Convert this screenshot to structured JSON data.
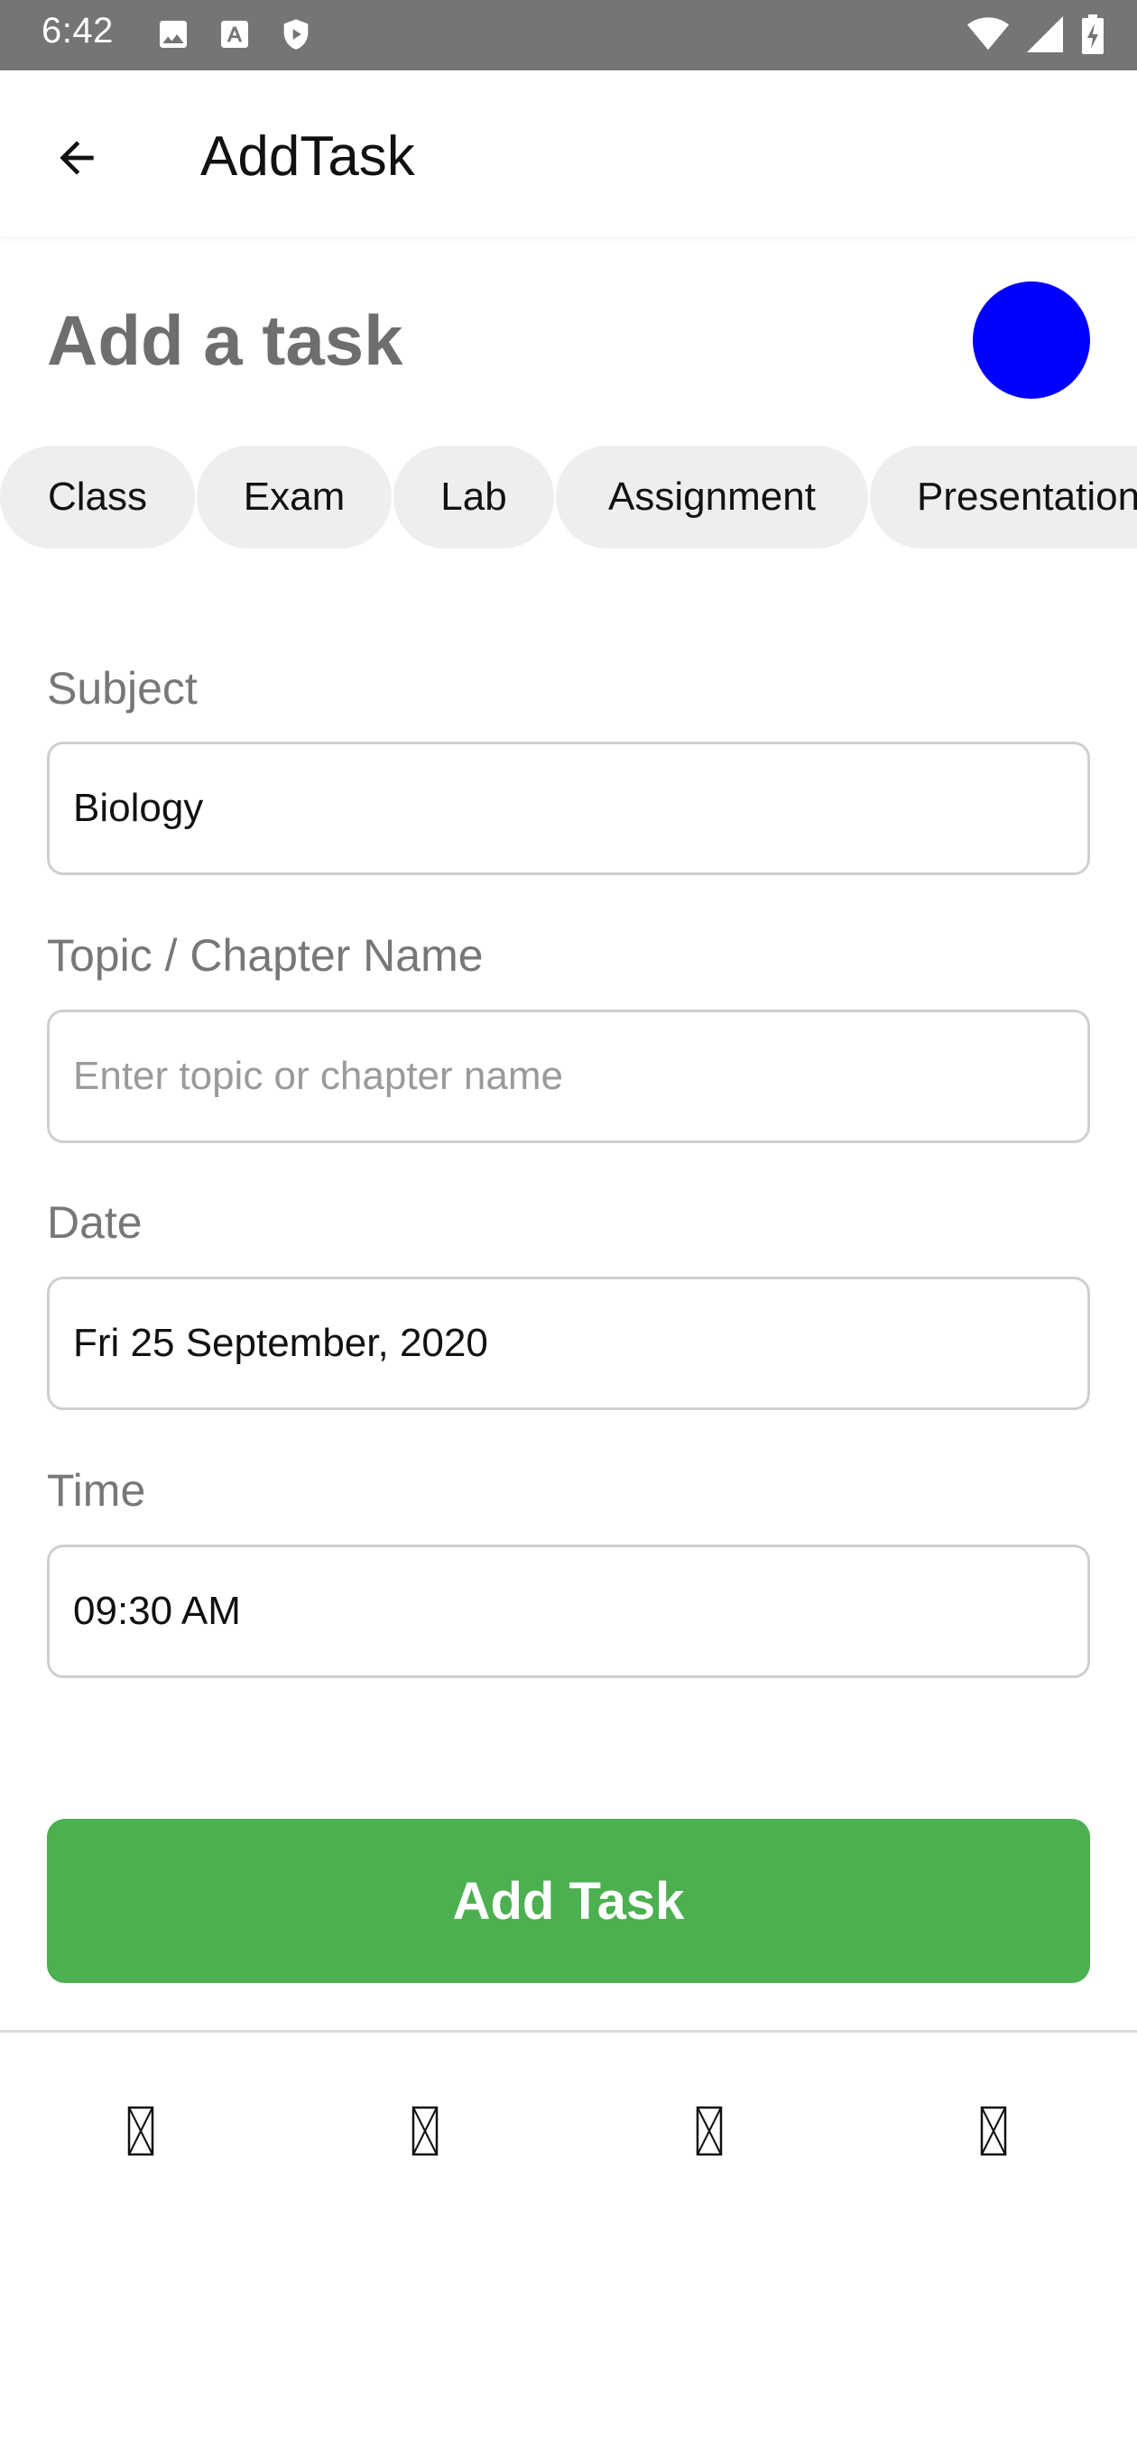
{
  "status_bar": {
    "time": "6:42",
    "left_icons": [
      "image-icon",
      "font-icon",
      "shield-play-icon"
    ],
    "right_icons": [
      "wifi-icon",
      "cell-signal-icon",
      "battery-charging-icon"
    ]
  },
  "app_bar": {
    "back_icon": "arrow-back-icon",
    "title": "AddTask"
  },
  "header": {
    "heading": "Add a task",
    "selected_color": "#0000ff"
  },
  "chips": [
    {
      "label": "Class"
    },
    {
      "label": "Exam"
    },
    {
      "label": "Lab"
    },
    {
      "label": "Assignment"
    },
    {
      "label": "Presentation"
    }
  ],
  "form": {
    "subject": {
      "label": "Subject",
      "value": "Biology"
    },
    "topic": {
      "label": "Topic / Chapter Name",
      "value": "",
      "placeholder": "Enter topic or chapter name"
    },
    "date": {
      "label": "Date",
      "value": "Fri 25 September, 2020"
    },
    "time": {
      "label": "Time",
      "value": "09:30 AM"
    }
  },
  "actions": {
    "add_task_label": "Add Task",
    "add_task_color": "#4caf50"
  },
  "bottom_nav": {
    "items": [
      "missing-glyph-icon",
      "missing-glyph-icon",
      "missing-glyph-icon",
      "missing-glyph-icon"
    ]
  }
}
